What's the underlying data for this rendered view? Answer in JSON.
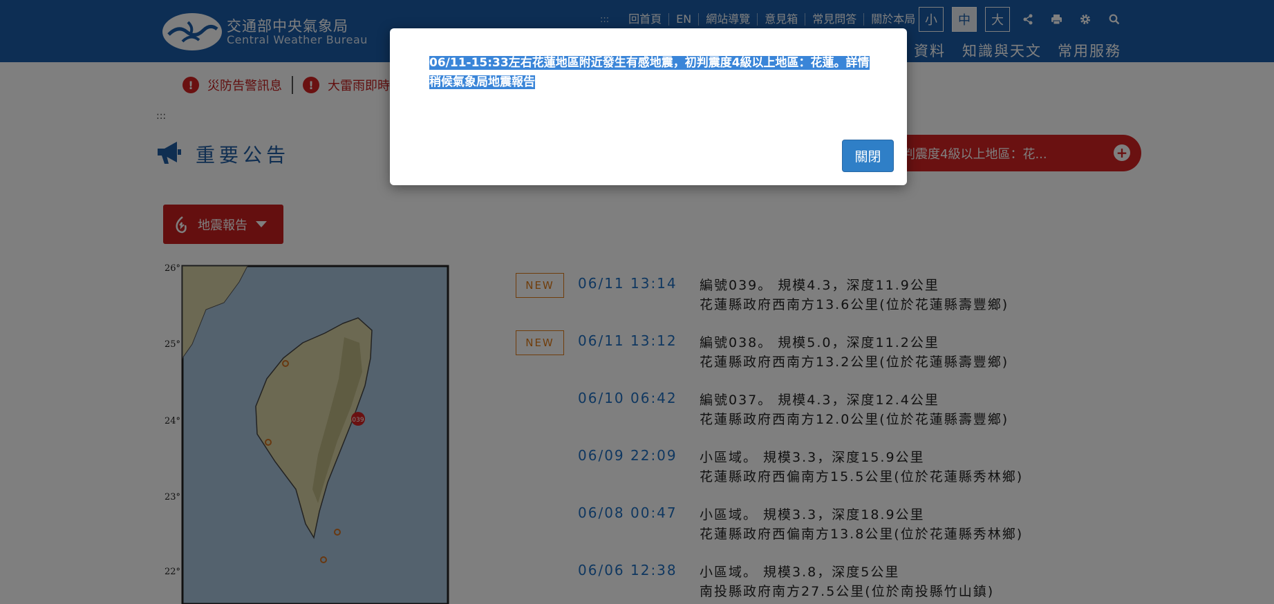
{
  "header": {
    "logo_zh": "交通部中央氣象局",
    "logo_en": "Central Weather Bureau",
    "top_links": [
      "回首頁",
      "EN",
      "網站導覽",
      "意見箱",
      "常見問答",
      "關於本局"
    ],
    "top_dots": ":::",
    "font_sizes": [
      "小",
      "中",
      "大"
    ],
    "main_nav": [
      "資料",
      "知識與天文",
      "常用服務"
    ]
  },
  "alerts": {
    "item1": "災防告警訊息",
    "item2": "大雷雨即時訊息",
    "icon_glyph": "!"
  },
  "breadcrumb": ":::",
  "section_title": "重要公告",
  "ticker_text": "判震度4級以上地區：花...",
  "ticker_plus": "+",
  "eq_button_label": "地震報告",
  "earthquakes": [
    {
      "badge": "NEW",
      "time": "06/11 13:14",
      "line1": "編號039。 規模4.3，深度11.9公里",
      "line2": "花蓮縣政府西南方13.6公里(位於花蓮縣壽豐鄉)"
    },
    {
      "badge": "NEW",
      "time": "06/11 13:12",
      "line1": "編號038。 規模5.0，深度11.2公里",
      "line2": "花蓮縣政府西南方13.2公里(位於花蓮縣壽豐鄉)"
    },
    {
      "badge": "",
      "time": "06/10 06:42",
      "line1": "編號037。 規模4.3，深度12.4公里",
      "line2": "花蓮縣政府西南方12.0公里(位於花蓮縣壽豐鄉)"
    },
    {
      "badge": "",
      "time": "06/09 22:09",
      "line1": "小區域。 規模3.3，深度15.9公里",
      "line2": "花蓮縣政府西偏南方15.5公里(位於花蓮縣秀林鄉)"
    },
    {
      "badge": "",
      "time": "06/08 00:47",
      "line1": "小區域。 規模3.3，深度18.9公里",
      "line2": "花蓮縣政府西偏南方13.8公里(位於花蓮縣秀林鄉)"
    },
    {
      "badge": "",
      "time": "06/06 12:38",
      "line1": "小區域。 規模3.8，深度5公里",
      "line2": "南投縣政府南方27.5公里(位於南投縣竹山鎮)"
    }
  ],
  "map": {
    "lat_labels": [
      "26°",
      "25°",
      "24°",
      "23°",
      "22°"
    ],
    "marker_label": "039"
  },
  "modal": {
    "line1": "06/11-15:33左右花蓮地區附近發生有感地震，初判震度4級以上地區：花蓮。詳情",
    "line2": "稍候氣象局地震報告",
    "close_label": "關閉"
  },
  "colors": {
    "header_bg": "#1a5da8",
    "accent_red": "#d42222",
    "new_orange": "#e07b17",
    "link_blue": "#1f6fc1",
    "selection": "#3a85d8"
  }
}
